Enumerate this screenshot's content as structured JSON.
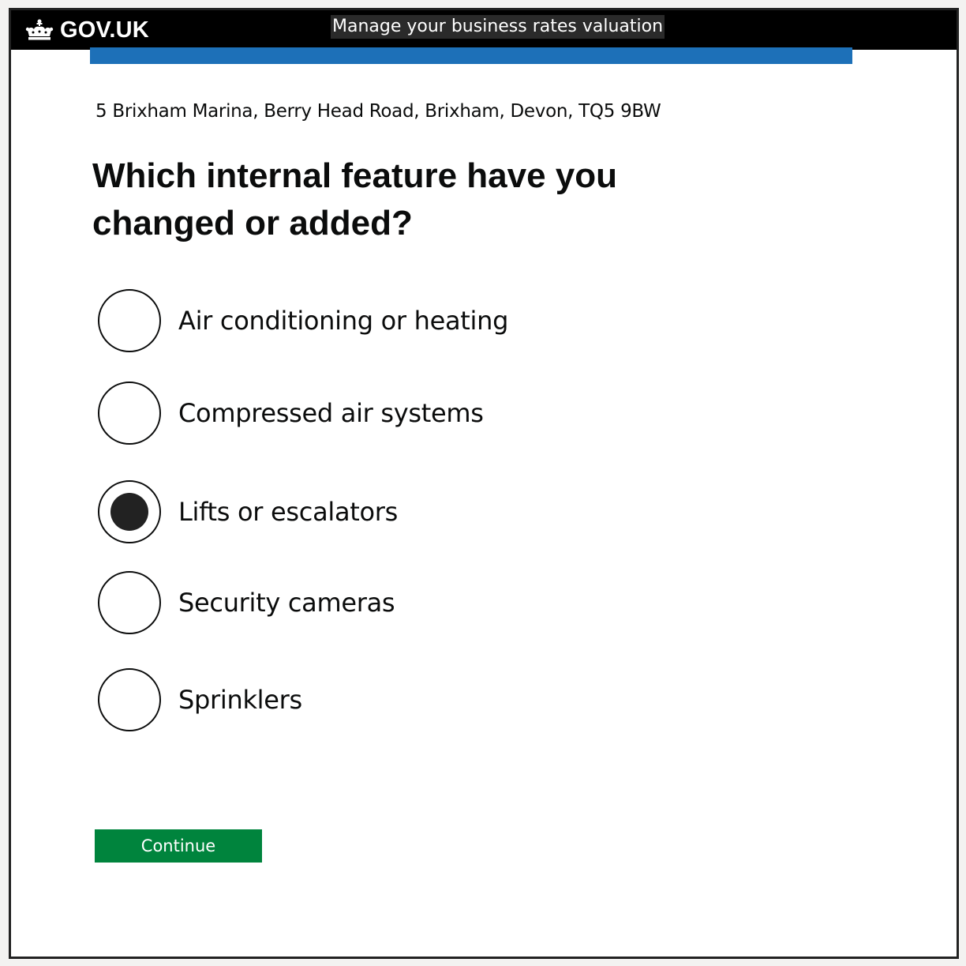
{
  "header": {
    "logo_text": "GOV.UK",
    "logo_icon": "crown-icon",
    "service_name": "Manage your business rates valuation",
    "colors": {
      "background": "#000000",
      "stripe": "#1d70b8"
    }
  },
  "main": {
    "address": "5 Brixham Marina, Berry Head Road, Brixham, Devon, TQ5 9BW",
    "heading": "Which internal feature have you changed or added?",
    "options": [
      {
        "label": "Air conditioning or heating",
        "selected": false
      },
      {
        "label": "Compressed air systems",
        "selected": false
      },
      {
        "label": "Lifts or escalators",
        "selected": true
      },
      {
        "label": "Security cameras",
        "selected": false
      },
      {
        "label": "Sprinklers",
        "selected": false
      }
    ],
    "continue_label": "Continue",
    "colors": {
      "button": "#00843d",
      "text": "#0b0c0c"
    }
  }
}
